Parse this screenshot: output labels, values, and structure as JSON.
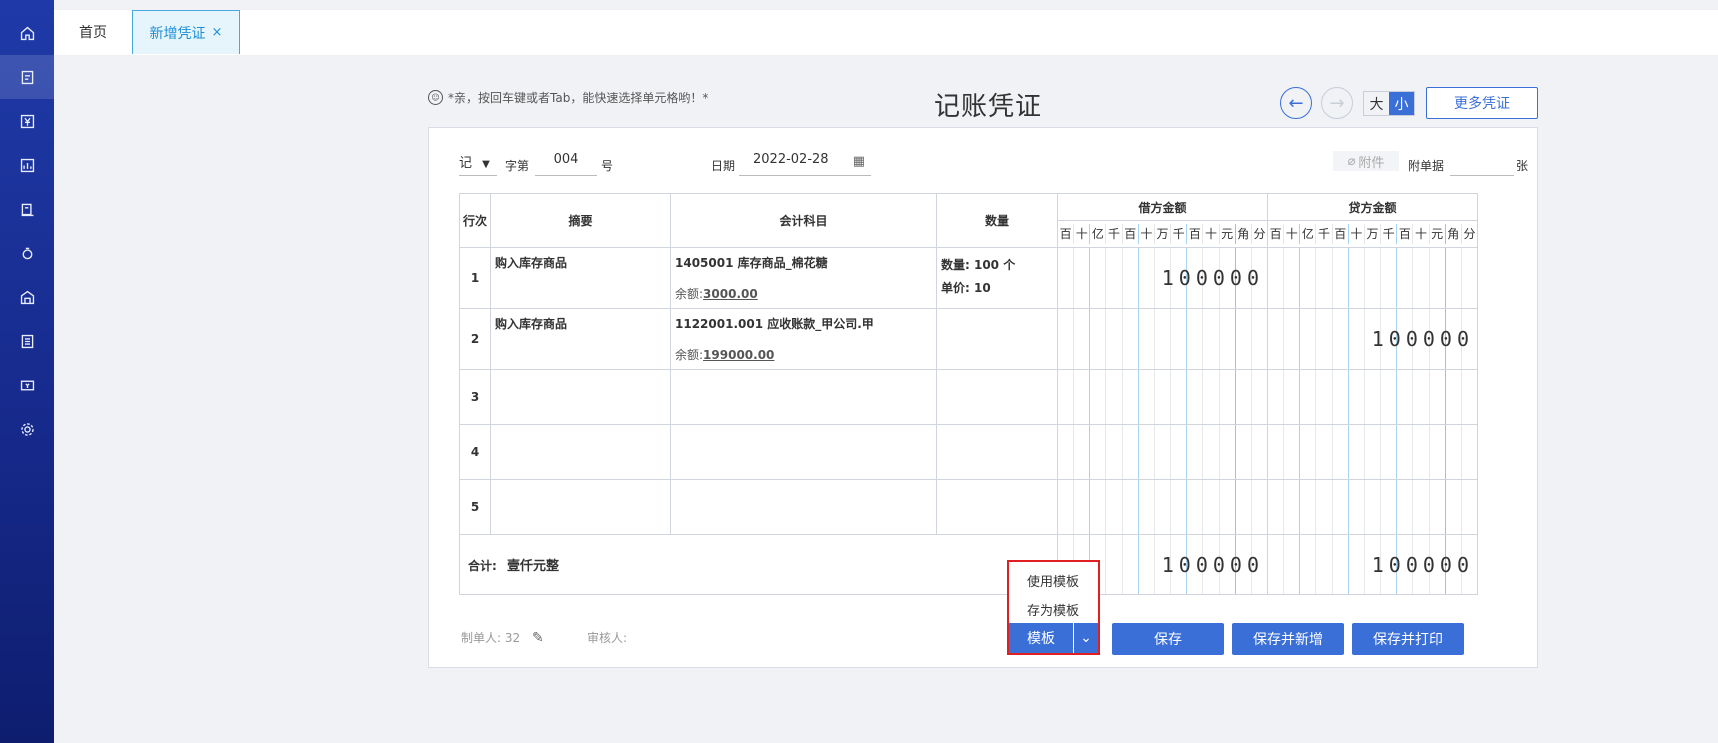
{
  "tabs": {
    "home": "首页",
    "current": "新增凭证",
    "close": "×"
  },
  "hint": "*亲，按回车键或者Tab，能快速选择单元格哟！*",
  "title": "记账凭证",
  "size_toggle": {
    "large": "大",
    "small": "小"
  },
  "more_button": "更多凭证",
  "meta": {
    "word": "记",
    "word_label": "字第",
    "number": "004",
    "number_suffix": "号",
    "date_label": "日期",
    "date": "2022-02-28",
    "attach_label": "附件",
    "docs_label": "附单据",
    "docs_suffix": "张"
  },
  "table": {
    "headers": {
      "row": "行次",
      "summary": "摘要",
      "account": "会计科目",
      "qty": "数量",
      "debit": "借方金额",
      "credit": "贷方金额"
    },
    "units": [
      "百",
      "十",
      "亿",
      "千",
      "百",
      "十",
      "万",
      "千",
      "百",
      "十",
      "元",
      "角",
      "分"
    ],
    "rows": [
      {
        "num": "1",
        "summary": "购入库存商品",
        "account": "1405001 库存商品_棉花糖",
        "balance_label": "余额:",
        "balance": "3000.00",
        "qty_line1": "数量: 100 个",
        "qty_line2": "单价: 10",
        "debit": "100000",
        "credit": ""
      },
      {
        "num": "2",
        "summary": "购入库存商品",
        "account": "1122001.001 应收账款_甲公司.甲",
        "balance_label": "余额:",
        "balance": "199000.00",
        "qty_line1": "",
        "qty_line2": "",
        "debit": "",
        "credit": "100000"
      },
      {
        "num": "3",
        "summary": "",
        "account": "",
        "balance_label": "",
        "balance": "",
        "qty_line1": "",
        "qty_line2": "",
        "debit": "",
        "credit": ""
      },
      {
        "num": "4",
        "summary": "",
        "account": "",
        "balance_label": "",
        "balance": "",
        "qty_line1": "",
        "qty_line2": "",
        "debit": "",
        "credit": ""
      },
      {
        "num": "5",
        "summary": "",
        "account": "",
        "balance_label": "",
        "balance": "",
        "qty_line1": "",
        "qty_line2": "",
        "debit": "",
        "credit": ""
      }
    ],
    "total_label": "合计:",
    "total_text": "壹仟元整",
    "total_debit": "100000",
    "total_credit": "100000"
  },
  "footer": {
    "maker": "制单人: 32",
    "reviewer": "审核人:"
  },
  "template_menu": {
    "use": "使用模板",
    "save_as": "存为模板",
    "button": "模板"
  },
  "buttons": {
    "save": "保存",
    "save_new": "保存并新增",
    "save_print": "保存并打印"
  }
}
